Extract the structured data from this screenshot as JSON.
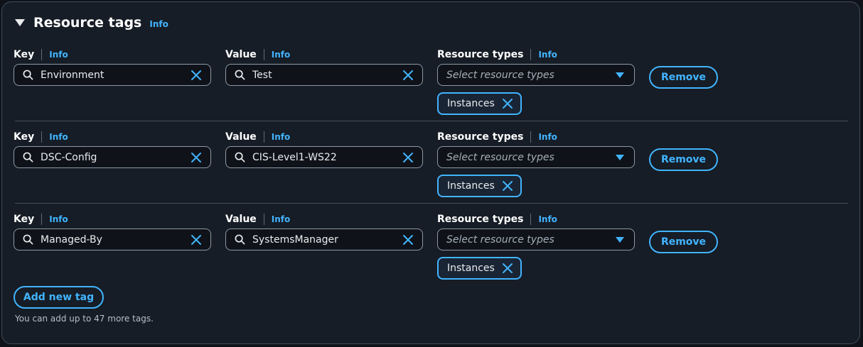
{
  "section": {
    "title": "Resource tags",
    "info": "Info"
  },
  "labels": {
    "key": "Key",
    "value": "Value",
    "resource_types": "Resource types",
    "info": "Info"
  },
  "rows": [
    {
      "key": "Environment",
      "value": "Test",
      "resource_placeholder": "Select resource types",
      "token": "Instances",
      "remove": "Remove"
    },
    {
      "key": "DSC-Config",
      "value": "CIS-Level1-WS22",
      "resource_placeholder": "Select resource types",
      "token": "Instances",
      "remove": "Remove"
    },
    {
      "key": "Managed-By",
      "value": "SystemsManager",
      "resource_placeholder": "Select resource types",
      "token": "Instances",
      "remove": "Remove"
    }
  ],
  "add_button": "Add new tag",
  "hint": "You can add up to 47 more tags.",
  "colors": {
    "accent": "#42b4ff",
    "panel_bg": "#161d26",
    "border": "#414d5c",
    "field_border": "#8d99a8"
  }
}
